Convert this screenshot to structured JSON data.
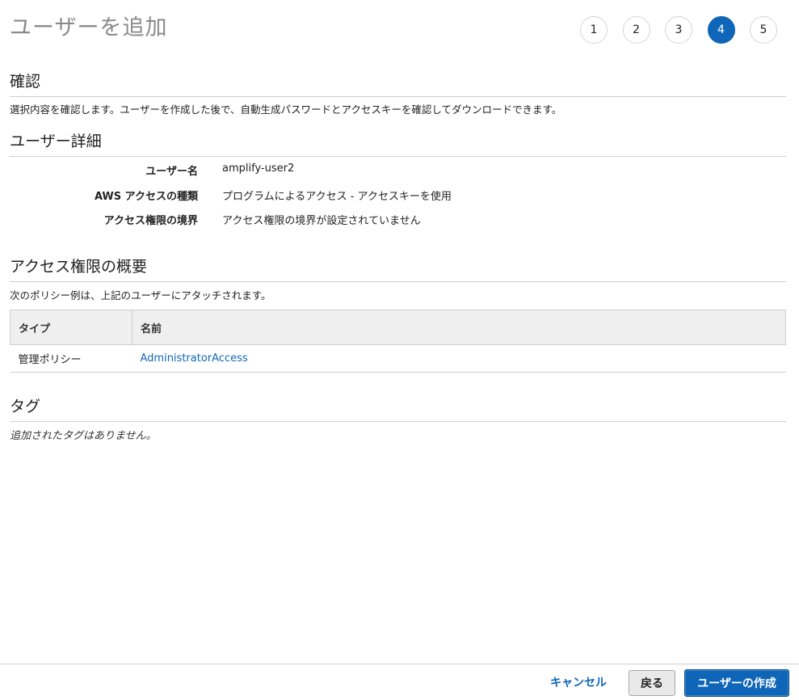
{
  "page": {
    "title": "ユーザーを追加"
  },
  "steps": [
    "1",
    "2",
    "3",
    "4",
    "5"
  ],
  "current_step": "4",
  "review": {
    "title": "確認",
    "description": "選択内容を確認します。ユーザーを作成した後で、自動生成パスワードとアクセスキーを確認してダウンロードできます。"
  },
  "user_details": {
    "title": "ユーザー詳細",
    "rows": [
      {
        "label": "ユーザー名",
        "value": "amplify-user2"
      },
      {
        "label": "AWS アクセスの種類",
        "value": "プログラムによるアクセス - アクセスキーを使用"
      },
      {
        "label": "アクセス権限の境界",
        "value": "アクセス権限の境界が設定されていません"
      }
    ]
  },
  "permissions": {
    "title": "アクセス権限の概要",
    "description": "次のポリシー例は、上記のユーザーにアタッチされます。",
    "columns": [
      "タイプ",
      "名前"
    ],
    "rows": [
      {
        "type": "管理ポリシー",
        "name": "AdministratorAccess"
      }
    ]
  },
  "tags": {
    "title": "タグ",
    "empty_text": "追加されたタグはありません。"
  },
  "footer": {
    "cancel_label": "キャンセル",
    "back_label": "戻る",
    "create_label": "ユーザーの作成"
  },
  "colors": {
    "accent": "#0f66b8",
    "title_gray": "#8a8a8a",
    "border": "#cfcfcf",
    "table_header_bg": "#efefef"
  }
}
